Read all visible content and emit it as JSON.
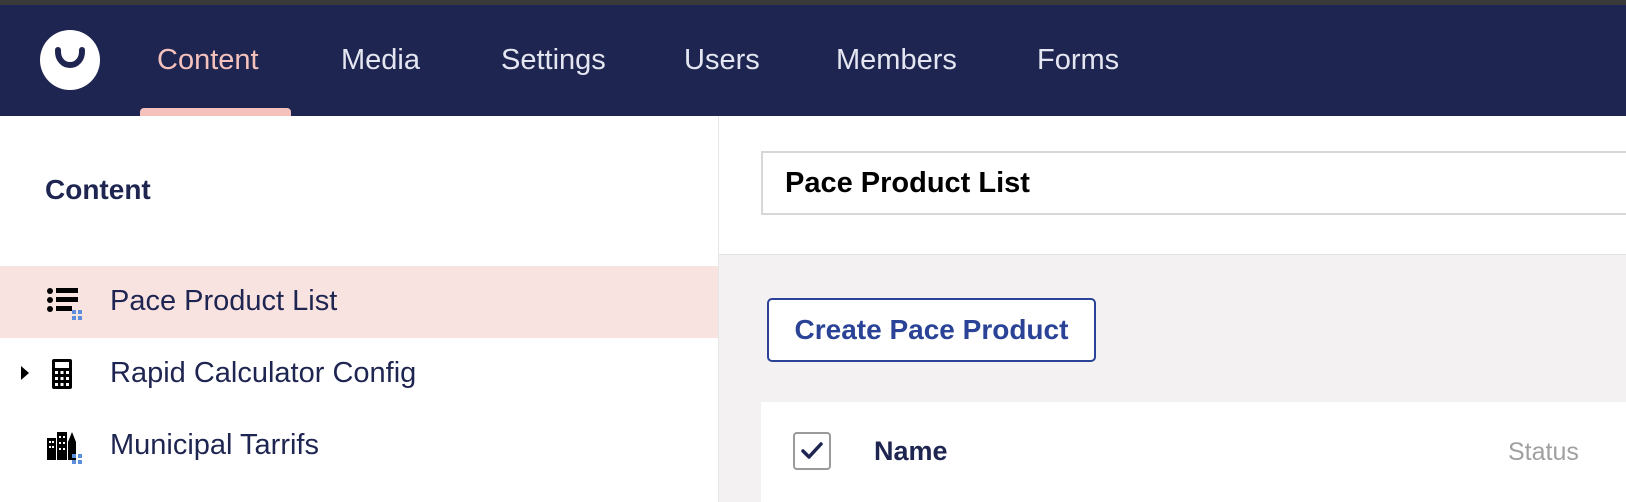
{
  "app": {
    "colors": {
      "header_bg": "#1e2550",
      "accent": "#f5c1bc",
      "button_blue": "#2a4396"
    },
    "nav": [
      {
        "label": "Content",
        "active": true
      },
      {
        "label": "Media",
        "active": false
      },
      {
        "label": "Settings",
        "active": false
      },
      {
        "label": "Users",
        "active": false
      },
      {
        "label": "Members",
        "active": false
      },
      {
        "label": "Forms",
        "active": false
      }
    ]
  },
  "sidebar": {
    "title": "Content",
    "items": [
      {
        "label": "Pace Product List",
        "icon": "list-icon",
        "selected": true,
        "expandable": false
      },
      {
        "label": "Rapid Calculator Config",
        "icon": "calculator-icon",
        "selected": false,
        "expandable": true
      },
      {
        "label": "Municipal Tarrifs",
        "icon": "buildings-icon",
        "selected": false,
        "expandable": false
      }
    ]
  },
  "editor": {
    "name_value": "Pace Product List",
    "create_button_label": "Create Pace Product",
    "table": {
      "columns": [
        "Name",
        "Status"
      ],
      "select_all_checked": true
    }
  }
}
